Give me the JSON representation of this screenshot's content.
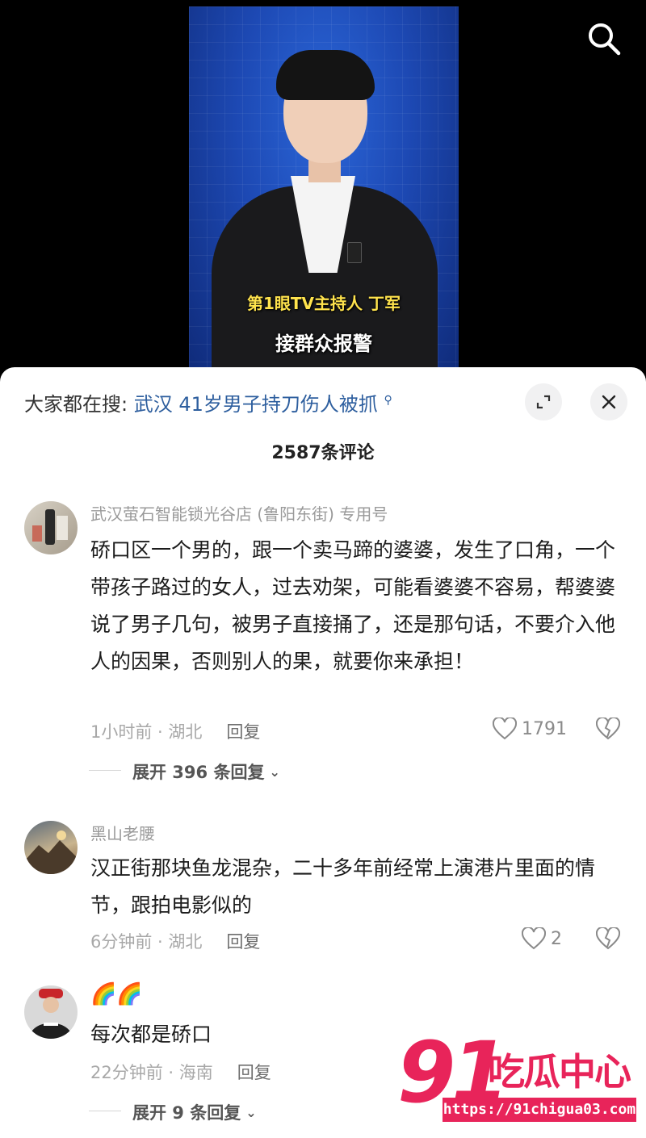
{
  "video": {
    "caption_line1": "第1眼TV主持人 丁军",
    "caption_line2": "接群众报警"
  },
  "search_prompt": {
    "prefix": "大家都在搜:",
    "keyword": "武汉 41岁男子持刀伤人被抓"
  },
  "comment_count_title": "2587条评论",
  "comments": [
    {
      "username": "武汉萤石智能锁光谷店 (鲁阳东街) 专用号",
      "text": "硚口区一个男的，跟一个卖马蹄的婆婆，发生了口角，一个带孩子路过的女人，过去劝架，可能看婆婆不容易，帮婆婆说了男子几句，被男子直接捅了，还是那句话，不要介入他人的因果，否则别人的果，就要你来承担！",
      "time_location": "1小时前 · 湖北",
      "reply_label": "回复",
      "likes": "1791",
      "expand_label": "展开 396 条回复"
    },
    {
      "username": "黑山老腰",
      "text": "汉正街那块鱼龙混杂，二十多年前经常上演港片里面的情节，跟拍电影似的",
      "time_location": "6分钟前 · 湖北",
      "reply_label": "回复",
      "likes": "2"
    },
    {
      "username": "🌈🌈",
      "text": "每次都是硚口",
      "time_location": "22分钟前 · 海南",
      "reply_label": "回复",
      "expand_label": "展开 9 条回复"
    }
  ],
  "watermark": {
    "number": "91",
    "name": "吃瓜中心",
    "url": "https://91chigua03.com"
  },
  "icons": [
    "search-icon",
    "expand-icon",
    "close-icon",
    "heart-icon",
    "dislike-heart-icon",
    "chevron-down-icon"
  ],
  "colors": {
    "keyword_blue": "#2d5e9e",
    "watermark_pink": "#e8245a",
    "meta_gray": "#a8a8a8"
  }
}
